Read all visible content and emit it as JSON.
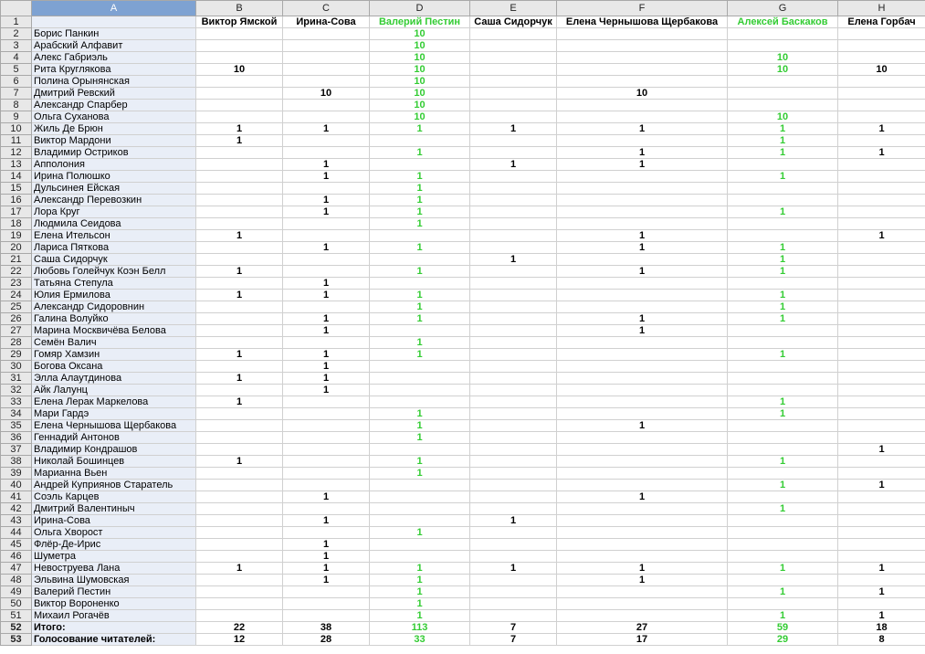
{
  "column_letters": [
    "A",
    "B",
    "C",
    "D",
    "E",
    "F",
    "G",
    "H"
  ],
  "columns": [
    "",
    "Виктор Ямской",
    "Ирина-Сова",
    "Валерий Пестин",
    "Саша Сидорчук",
    "Елена Чернышова Щербакова",
    "Алексей Баскаков",
    "Елена Горбач"
  ],
  "green_columns": [
    3,
    6
  ],
  "active_column": 0,
  "highlight_color": "#33cc33",
  "rows": [
    {
      "name": "Борис Панкин",
      "v": [
        "",
        "",
        "10",
        "",
        "",
        "",
        ""
      ]
    },
    {
      "name": "Арабский Алфавит",
      "v": [
        "",
        "",
        "10",
        "",
        "",
        "",
        ""
      ]
    },
    {
      "name": "Алекс Габриэль",
      "v": [
        "",
        "",
        "10",
        "",
        "",
        "10",
        ""
      ]
    },
    {
      "name": "Рита Круглякова",
      "v": [
        "10",
        "",
        "10",
        "",
        "",
        "10",
        "10"
      ]
    },
    {
      "name": "Полина Орынянская",
      "v": [
        "",
        "",
        "10",
        "",
        "",
        "",
        ""
      ]
    },
    {
      "name": "Дмитрий Ревский",
      "v": [
        "",
        "10",
        "10",
        "",
        "10",
        "",
        ""
      ]
    },
    {
      "name": "Александр Спарбер",
      "v": [
        "",
        "",
        "10",
        "",
        "",
        "",
        ""
      ]
    },
    {
      "name": "Ольга Суханова",
      "v": [
        "",
        "",
        "10",
        "",
        "",
        "10",
        ""
      ]
    },
    {
      "name": "Жиль Де Брюн",
      "v": [
        "1",
        "1",
        "1",
        "1",
        "1",
        "1",
        "1"
      ]
    },
    {
      "name": "Виктор Мардони",
      "v": [
        "1",
        "",
        "",
        "",
        "",
        "1",
        ""
      ]
    },
    {
      "name": "Владимир Остриков",
      "v": [
        "",
        "",
        "1",
        "",
        "1",
        "1",
        "1"
      ]
    },
    {
      "name": "Апполония",
      "v": [
        "",
        "1",
        "",
        "1",
        "1",
        "",
        ""
      ]
    },
    {
      "name": "Ирина Полюшко",
      "v": [
        "",
        "1",
        "1",
        "",
        "",
        "1",
        ""
      ]
    },
    {
      "name": "Дульсинея Ейская",
      "v": [
        "",
        "",
        "1",
        "",
        "",
        "",
        ""
      ]
    },
    {
      "name": "Александр Перевозкин",
      "v": [
        "",
        "1",
        "1",
        "",
        "",
        "",
        ""
      ]
    },
    {
      "name": "Лора Круг",
      "v": [
        "",
        "1",
        "1",
        "",
        "",
        "1",
        ""
      ]
    },
    {
      "name": "Людмила Сеидова",
      "v": [
        "",
        "",
        "1",
        "",
        "",
        "",
        ""
      ]
    },
    {
      "name": "Елена Ительсон",
      "v": [
        "1",
        "",
        "",
        "",
        "1",
        "",
        "1"
      ]
    },
    {
      "name": "Лариса Пяткова",
      "v": [
        "",
        "1",
        "1",
        "",
        "1",
        "1",
        ""
      ]
    },
    {
      "name": "Саша Сидорчук",
      "v": [
        "",
        "",
        "",
        "1",
        "",
        "1",
        ""
      ]
    },
    {
      "name": "Любовь Голейчук Коэн Белл",
      "v": [
        "1",
        "",
        "1",
        "",
        "1",
        "1",
        ""
      ]
    },
    {
      "name": "Татьяна Степула",
      "v": [
        "",
        "1",
        "",
        "",
        "",
        "",
        ""
      ]
    },
    {
      "name": "Юлия Ермилова",
      "v": [
        "1",
        "1",
        "1",
        "",
        "",
        "1",
        ""
      ]
    },
    {
      "name": "Александр Сидоровнин",
      "v": [
        "",
        "",
        "1",
        "",
        "",
        "1",
        ""
      ]
    },
    {
      "name": "Галина Волуйко",
      "v": [
        "",
        "1",
        "1",
        "",
        "1",
        "1",
        ""
      ]
    },
    {
      "name": "Марина Москвичёва Белова",
      "v": [
        "",
        "1",
        "",
        "",
        "1",
        "",
        ""
      ]
    },
    {
      "name": "Семён Валич",
      "v": [
        "",
        "",
        "1",
        "",
        "",
        "",
        ""
      ]
    },
    {
      "name": "Гомяр Хамзин",
      "v": [
        "1",
        "1",
        "1",
        "",
        "",
        "1",
        ""
      ]
    },
    {
      "name": "Богова Оксана",
      "v": [
        "",
        "1",
        "",
        "",
        "",
        "",
        ""
      ]
    },
    {
      "name": "Элла Алаутдинова",
      "v": [
        "1",
        "1",
        "",
        "",
        "",
        "",
        ""
      ]
    },
    {
      "name": "Айк Лалунц",
      "v": [
        "",
        "1",
        "",
        "",
        "",
        "",
        ""
      ]
    },
    {
      "name": "Елена Лерак Маркелова",
      "v": [
        "1",
        "",
        "",
        "",
        "",
        "1",
        ""
      ]
    },
    {
      "name": "Мари Гардэ",
      "v": [
        "",
        "",
        "1",
        "",
        "",
        "1",
        ""
      ]
    },
    {
      "name": "Елена Чернышова Щербакова",
      "v": [
        "",
        "",
        "1",
        "",
        "1",
        "",
        ""
      ]
    },
    {
      "name": "Геннадий Антонов",
      "v": [
        "",
        "",
        "1",
        "",
        "",
        "",
        ""
      ]
    },
    {
      "name": "Владимир Кондрашов",
      "v": [
        "",
        "",
        "",
        "",
        "",
        "",
        "1"
      ]
    },
    {
      "name": "Николай Бошинцев",
      "v": [
        "1",
        "",
        "1",
        "",
        "",
        "1",
        ""
      ]
    },
    {
      "name": "Марианна Вьен",
      "v": [
        "",
        "",
        "1",
        "",
        "",
        "",
        ""
      ]
    },
    {
      "name": "Андрей Куприянов Старатель",
      "v": [
        "",
        "",
        "",
        "",
        "",
        "1",
        "1"
      ]
    },
    {
      "name": "Соэль Карцев",
      "v": [
        "",
        "1",
        "",
        "",
        "1",
        "",
        ""
      ]
    },
    {
      "name": "Дмитрий Валентиныч",
      "v": [
        "",
        "",
        "",
        "",
        "",
        "1",
        ""
      ]
    },
    {
      "name": "Ирина-Сова",
      "v": [
        "",
        "1",
        "",
        "1",
        "",
        "",
        ""
      ]
    },
    {
      "name": "Ольга Хворост",
      "v": [
        "",
        "",
        "1",
        "",
        "",
        "",
        ""
      ]
    },
    {
      "name": "Флёр-Де-Ирис",
      "v": [
        "",
        "1",
        "",
        "",
        "",
        "",
        ""
      ]
    },
    {
      "name": "Шуметра",
      "v": [
        "",
        "1",
        "",
        "",
        "",
        "",
        ""
      ]
    },
    {
      "name": "Невоструева Лана",
      "v": [
        "1",
        "1",
        "1",
        "1",
        "1",
        "1",
        "1"
      ]
    },
    {
      "name": "Эльвина Шумовская",
      "v": [
        "",
        "1",
        "1",
        "",
        "1",
        "",
        ""
      ]
    },
    {
      "name": "Валерий Пестин",
      "v": [
        "",
        "",
        "1",
        "",
        "",
        "1",
        "1"
      ]
    },
    {
      "name": "Виктор Вороненко",
      "v": [
        "",
        "",
        "1",
        "",
        "",
        "",
        ""
      ]
    },
    {
      "name": "Михаил Рогачёв",
      "v": [
        "",
        "",
        "1",
        "",
        "",
        "1",
        "1"
      ]
    }
  ],
  "totals": [
    {
      "name": "Итого:",
      "v": [
        "22",
        "38",
        "113",
        "7",
        "27",
        "59",
        "18"
      ]
    },
    {
      "name": "Голосование читателей:",
      "v": [
        "12",
        "28",
        "33",
        "7",
        "17",
        "29",
        "8"
      ]
    }
  ]
}
